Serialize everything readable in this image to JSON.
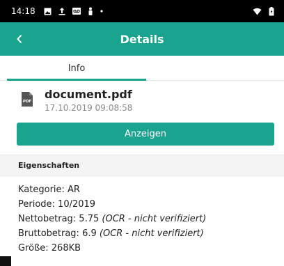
{
  "status_bar": {
    "time": "14:18",
    "icons": [
      "image-icon",
      "upload-icon",
      "voicemail-icon",
      "person-icon",
      "dot-icon"
    ],
    "right_icons": [
      "wifi-icon",
      "battery-icon"
    ]
  },
  "app_bar": {
    "back_icon": "chevron-left-icon",
    "title": "Details",
    "color": "#1aa38f"
  },
  "tabs": [
    {
      "label": "Info",
      "selected": true
    }
  ],
  "document": {
    "icon": "pdf-file-icon",
    "icon_label": "PDF",
    "name": "document.pdf",
    "date": "17.10.2019 09:08:58"
  },
  "view_button": {
    "label": "Anzeigen"
  },
  "properties": {
    "header": "Eigenschaften",
    "kategorie": "Kategorie: AR",
    "periode": "Periode: 10/2019",
    "netto_value": "Nettobetrag: 5.75",
    "netto_note": "(OCR - nicht verifiziert)",
    "brutto_value": "Bruttobetrag: 6.9",
    "brutto_note": "(OCR - nicht verifiziert)",
    "groesse": "Größe: 268KB"
  }
}
